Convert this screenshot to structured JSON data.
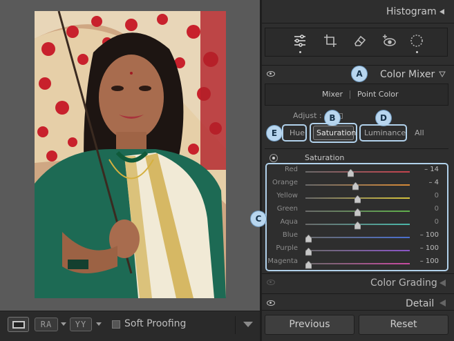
{
  "toolbar": {
    "ra_label": "RA",
    "yy_label": "YY",
    "soft_proofing": "Soft Proofing"
  },
  "panel": {
    "histogram": "Histogram",
    "color_mixer": {
      "title": "Color Mixer",
      "tabs": [
        "Mixer",
        "Point Color"
      ],
      "adjust_label": "Adjust :",
      "buttons": [
        "Hue",
        "Saturation",
        "Luminance",
        "All"
      ],
      "selected": "Saturation",
      "group_label": "Saturation",
      "sliders": [
        {
          "label": "Red",
          "value": "– 14",
          "num": -14,
          "color": "#c8434d"
        },
        {
          "label": "Orange",
          "value": "– 4",
          "num": -4,
          "color": "#d88a37"
        },
        {
          "label": "Yellow",
          "value": "0",
          "num": 0,
          "color": "#d6c33c"
        },
        {
          "label": "Green",
          "value": "0",
          "num": 0,
          "color": "#5fb04b"
        },
        {
          "label": "Aqua",
          "value": "0",
          "num": 0,
          "color": "#4ab7a9"
        },
        {
          "label": "Blue",
          "value": "– 100",
          "num": -100,
          "color": "#4a6fd0"
        },
        {
          "label": "Purple",
          "value": "– 100",
          "num": -100,
          "color": "#8b56c8"
        },
        {
          "label": "Magenta",
          "value": "– 100",
          "num": -100,
          "color": "#c94aa2"
        }
      ]
    },
    "color_grading": "Color Grading",
    "detail": "Detail",
    "previous": "Previous",
    "reset": "Reset"
  },
  "badges": {
    "a": "A",
    "b": "B",
    "c": "C",
    "d": "D",
    "e": "E"
  },
  "colors": {
    "highlight": "#b2d2ec",
    "badge_fill": "#b8d6ef"
  },
  "icons": [
    "sliders-icon",
    "crop-icon",
    "eraser-icon",
    "redeye-icon",
    "mask-circle-icon",
    "eye-icon"
  ]
}
